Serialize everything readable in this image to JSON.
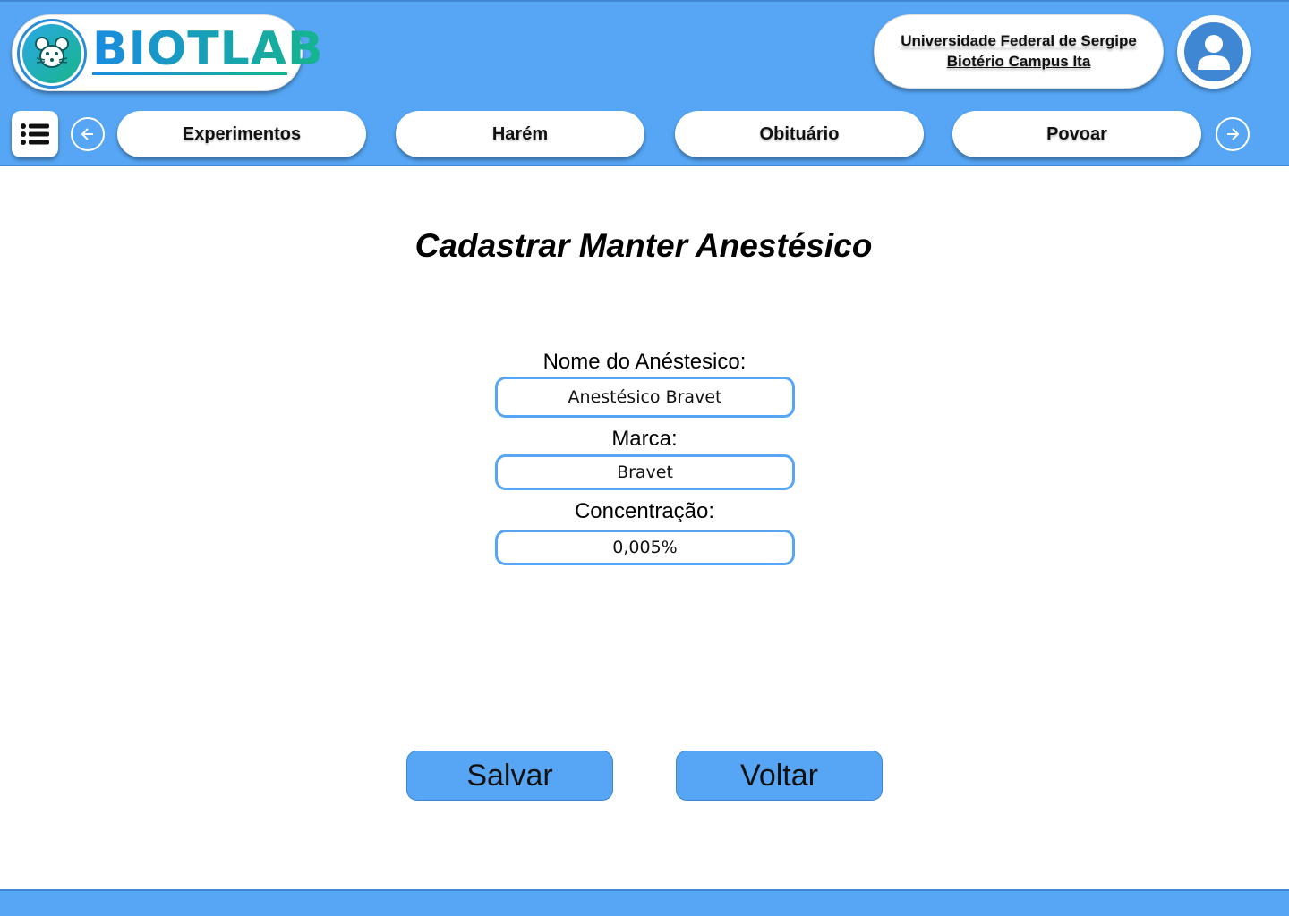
{
  "header": {
    "brand": "BIOTLAB",
    "institution": {
      "line1": "Universidade Federal de Sergipe",
      "line2": "Biotério Campus Ita"
    },
    "avatar_icon": "user-icon",
    "menu_icon": "list-icon",
    "nav": {
      "prev_icon": "arrow-left-icon",
      "next_icon": "arrow-right-icon",
      "items": [
        {
          "label": "Experimentos"
        },
        {
          "label": "Harém"
        },
        {
          "label": "Obituário"
        },
        {
          "label": "Povoar"
        }
      ]
    }
  },
  "form": {
    "title": "Cadastrar Manter Anestésico",
    "fields": [
      {
        "label": "Nome do Anéstesico:",
        "value": "Anestésico Bravet"
      },
      {
        "label": "Marca:",
        "value": "Bravet"
      },
      {
        "label": "Concentração:",
        "value": "0,005%"
      }
    ],
    "actions": {
      "save_label": "Salvar",
      "back_label": "Voltar"
    }
  },
  "colors": {
    "primary": "#56a6f5",
    "primary_dark": "#3f86d3",
    "brand_gradient_start": "#1a8be0",
    "brand_gradient_end": "#15b58d"
  }
}
